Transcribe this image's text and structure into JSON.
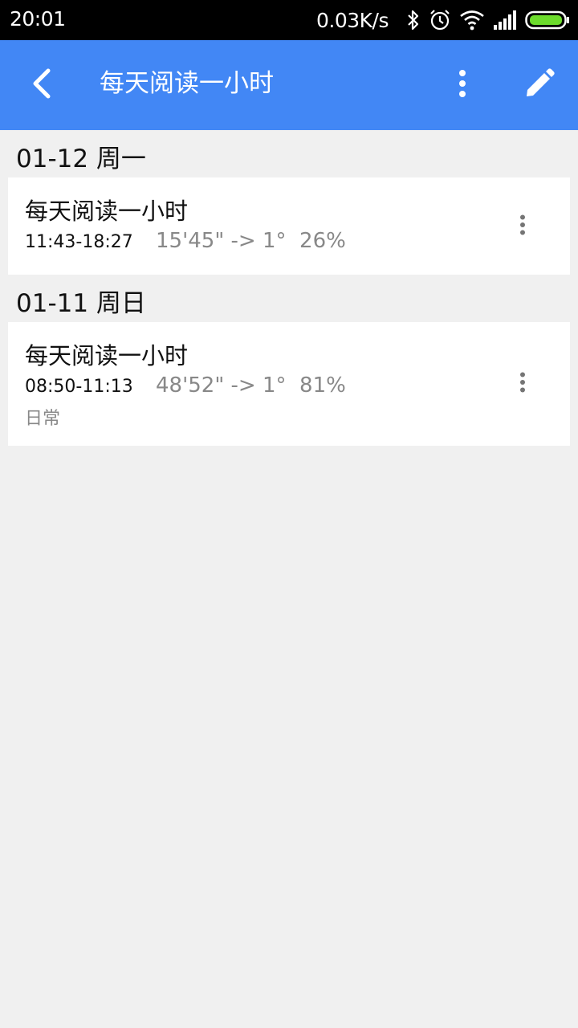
{
  "status_bar": {
    "time": "20:01",
    "net_speed": "0.03K/s",
    "icons": [
      "bluetooth-icon",
      "alarm-icon",
      "wifi-icon",
      "signal-icon",
      "battery-icon"
    ]
  },
  "app_bar": {
    "title": "每天阅读一小时",
    "color": "#4287f5",
    "icons": [
      "back-arrow-icon",
      "more-vert-icon",
      "edit-pencil-icon"
    ]
  },
  "groups": [
    {
      "date_label": "01-12 周一",
      "items": [
        {
          "title": "每天阅读一小时",
          "time_range": "11:43-18:27",
          "stats": "15'45\" -> 1°  26%",
          "tag": ""
        }
      ]
    },
    {
      "date_label": "01-11 周日",
      "items": [
        {
          "title": "每天阅读一小时",
          "time_range": "08:50-11:13",
          "stats": "48'52\" -> 1°  81%",
          "tag": "日常"
        }
      ]
    }
  ]
}
